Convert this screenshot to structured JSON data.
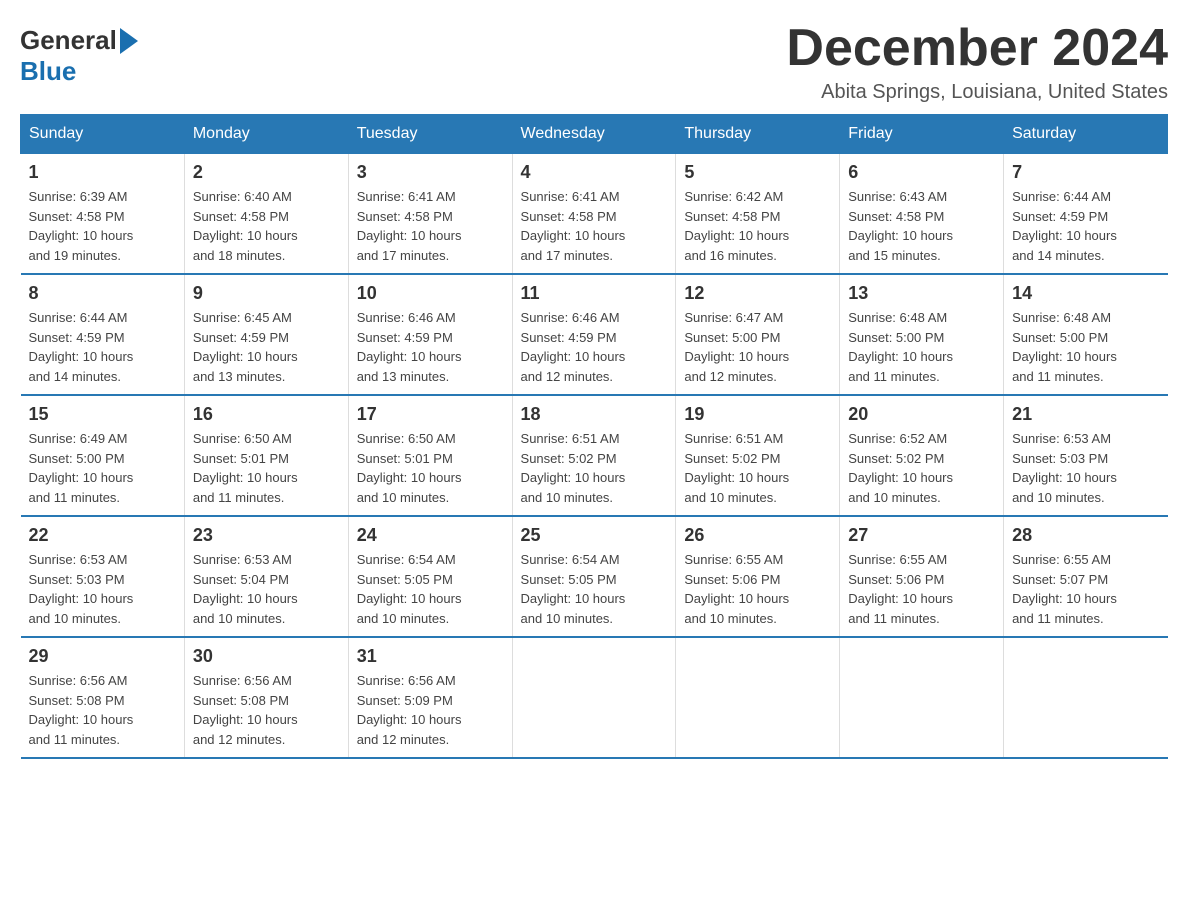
{
  "header": {
    "logo": {
      "general": "General",
      "blue": "Blue"
    },
    "title": "December 2024",
    "location": "Abita Springs, Louisiana, United States"
  },
  "calendar": {
    "days_of_week": [
      "Sunday",
      "Monday",
      "Tuesday",
      "Wednesday",
      "Thursday",
      "Friday",
      "Saturday"
    ],
    "weeks": [
      [
        {
          "day": "1",
          "sunrise": "6:39 AM",
          "sunset": "4:58 PM",
          "daylight": "10 hours and 19 minutes."
        },
        {
          "day": "2",
          "sunrise": "6:40 AM",
          "sunset": "4:58 PM",
          "daylight": "10 hours and 18 minutes."
        },
        {
          "day": "3",
          "sunrise": "6:41 AM",
          "sunset": "4:58 PM",
          "daylight": "10 hours and 17 minutes."
        },
        {
          "day": "4",
          "sunrise": "6:41 AM",
          "sunset": "4:58 PM",
          "daylight": "10 hours and 17 minutes."
        },
        {
          "day": "5",
          "sunrise": "6:42 AM",
          "sunset": "4:58 PM",
          "daylight": "10 hours and 16 minutes."
        },
        {
          "day": "6",
          "sunrise": "6:43 AM",
          "sunset": "4:58 PM",
          "daylight": "10 hours and 15 minutes."
        },
        {
          "day": "7",
          "sunrise": "6:44 AM",
          "sunset": "4:59 PM",
          "daylight": "10 hours and 14 minutes."
        }
      ],
      [
        {
          "day": "8",
          "sunrise": "6:44 AM",
          "sunset": "4:59 PM",
          "daylight": "10 hours and 14 minutes."
        },
        {
          "day": "9",
          "sunrise": "6:45 AM",
          "sunset": "4:59 PM",
          "daylight": "10 hours and 13 minutes."
        },
        {
          "day": "10",
          "sunrise": "6:46 AM",
          "sunset": "4:59 PM",
          "daylight": "10 hours and 13 minutes."
        },
        {
          "day": "11",
          "sunrise": "6:46 AM",
          "sunset": "4:59 PM",
          "daylight": "10 hours and 12 minutes."
        },
        {
          "day": "12",
          "sunrise": "6:47 AM",
          "sunset": "5:00 PM",
          "daylight": "10 hours and 12 minutes."
        },
        {
          "day": "13",
          "sunrise": "6:48 AM",
          "sunset": "5:00 PM",
          "daylight": "10 hours and 11 minutes."
        },
        {
          "day": "14",
          "sunrise": "6:48 AM",
          "sunset": "5:00 PM",
          "daylight": "10 hours and 11 minutes."
        }
      ],
      [
        {
          "day": "15",
          "sunrise": "6:49 AM",
          "sunset": "5:00 PM",
          "daylight": "10 hours and 11 minutes."
        },
        {
          "day": "16",
          "sunrise": "6:50 AM",
          "sunset": "5:01 PM",
          "daylight": "10 hours and 11 minutes."
        },
        {
          "day": "17",
          "sunrise": "6:50 AM",
          "sunset": "5:01 PM",
          "daylight": "10 hours and 10 minutes."
        },
        {
          "day": "18",
          "sunrise": "6:51 AM",
          "sunset": "5:02 PM",
          "daylight": "10 hours and 10 minutes."
        },
        {
          "day": "19",
          "sunrise": "6:51 AM",
          "sunset": "5:02 PM",
          "daylight": "10 hours and 10 minutes."
        },
        {
          "day": "20",
          "sunrise": "6:52 AM",
          "sunset": "5:02 PM",
          "daylight": "10 hours and 10 minutes."
        },
        {
          "day": "21",
          "sunrise": "6:53 AM",
          "sunset": "5:03 PM",
          "daylight": "10 hours and 10 minutes."
        }
      ],
      [
        {
          "day": "22",
          "sunrise": "6:53 AM",
          "sunset": "5:03 PM",
          "daylight": "10 hours and 10 minutes."
        },
        {
          "day": "23",
          "sunrise": "6:53 AM",
          "sunset": "5:04 PM",
          "daylight": "10 hours and 10 minutes."
        },
        {
          "day": "24",
          "sunrise": "6:54 AM",
          "sunset": "5:05 PM",
          "daylight": "10 hours and 10 minutes."
        },
        {
          "day": "25",
          "sunrise": "6:54 AM",
          "sunset": "5:05 PM",
          "daylight": "10 hours and 10 minutes."
        },
        {
          "day": "26",
          "sunrise": "6:55 AM",
          "sunset": "5:06 PM",
          "daylight": "10 hours and 10 minutes."
        },
        {
          "day": "27",
          "sunrise": "6:55 AM",
          "sunset": "5:06 PM",
          "daylight": "10 hours and 11 minutes."
        },
        {
          "day": "28",
          "sunrise": "6:55 AM",
          "sunset": "5:07 PM",
          "daylight": "10 hours and 11 minutes."
        }
      ],
      [
        {
          "day": "29",
          "sunrise": "6:56 AM",
          "sunset": "5:08 PM",
          "daylight": "10 hours and 11 minutes."
        },
        {
          "day": "30",
          "sunrise": "6:56 AM",
          "sunset": "5:08 PM",
          "daylight": "10 hours and 12 minutes."
        },
        {
          "day": "31",
          "sunrise": "6:56 AM",
          "sunset": "5:09 PM",
          "daylight": "10 hours and 12 minutes."
        },
        null,
        null,
        null,
        null
      ]
    ],
    "labels": {
      "sunrise": "Sunrise:",
      "sunset": "Sunset:",
      "daylight": "Daylight:"
    }
  }
}
